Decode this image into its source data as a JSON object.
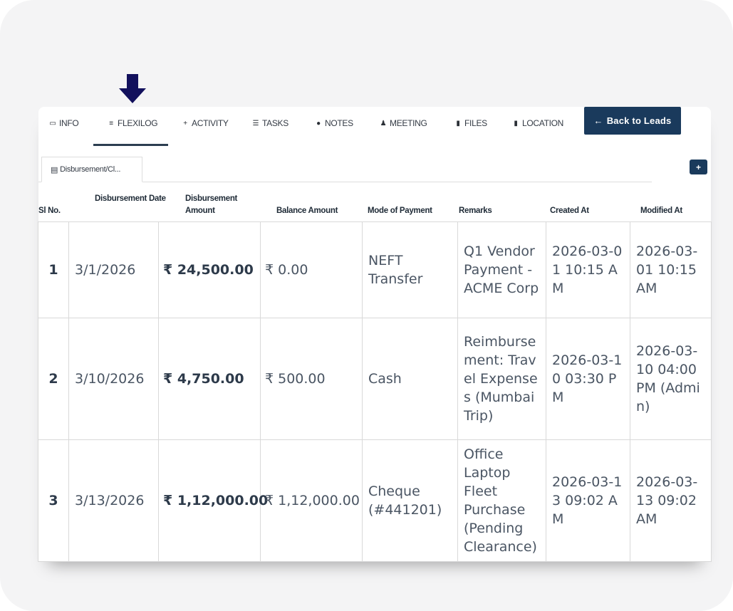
{
  "tabs": [
    {
      "icon": "id-card-icon",
      "glyph": "▭",
      "label": "INFO"
    },
    {
      "icon": "database-icon",
      "glyph": "≡",
      "label": "FLEXILOG"
    },
    {
      "icon": "plus-icon",
      "glyph": "+",
      "label": "ACTIVITY"
    },
    {
      "icon": "tasks-icon",
      "glyph": "☰",
      "label": "TASKS"
    },
    {
      "icon": "comments-icon",
      "glyph": "●",
      "label": "NOTES"
    },
    {
      "icon": "users-icon",
      "glyph": "♟",
      "label": "MEETING"
    },
    {
      "icon": "file-icon",
      "glyph": "▮",
      "label": "FILES"
    },
    {
      "icon": "file-icon",
      "glyph": "▮",
      "label": "LOCATION"
    }
  ],
  "active_tab": "FLEXILOG",
  "back_button": {
    "icon": "arrow-left-icon",
    "glyph": "←",
    "label": "Back to Leads"
  },
  "subtab": {
    "icon": "file-text-icon",
    "glyph": "▤",
    "label": "Disbursement/Cl..."
  },
  "add_button": {
    "icon": "plus-icon",
    "glyph": "+"
  },
  "columns": {
    "sl": "Sl No.",
    "date": "Disbursement Date",
    "amount": "Disbursement Amount",
    "balance": "Balance Amount",
    "mode": "Mode of Payment",
    "remarks": "Remarks",
    "created": "Created At",
    "modified": "Modified At"
  },
  "rows": [
    {
      "sl": "1",
      "date": "3/1/2026",
      "amount": "₹ 24,500.00",
      "balance": "₹ 0.00",
      "mode": "NEFT Transfer",
      "remarks": "Q1 Vendor Payment - ACME Corp",
      "created": "2026-03-01 10:15 AM",
      "modified": "2026-03-01 10:15 AM"
    },
    {
      "sl": "2",
      "date": "3/10/2026",
      "amount": "₹ 4,750.00",
      "balance": "₹ 500.00",
      "mode": "Cash",
      "remarks": "Reimbursement: Travel Expenses (Mumbai Trip)",
      "created": "2026-03-10 03:30 PM",
      "modified": "2026-03-10 04:00 PM (Admin)"
    },
    {
      "sl": "3",
      "date": "3/13/2026",
      "amount": "₹ 1,12,000.00",
      "balance": "₹ 1,12,000.00",
      "mode": "Cheque (#441201)",
      "remarks": "Office Laptop Fleet Purchase (Pending Clearance)",
      "created": "2026-03-13 09:02 AM",
      "modified": "2026-03-13 09:02 AM"
    }
  ],
  "colors": {
    "primary": "#1a3a5c",
    "pointer_arrow": "#12105c",
    "frame_background": "#f4f4f5"
  }
}
